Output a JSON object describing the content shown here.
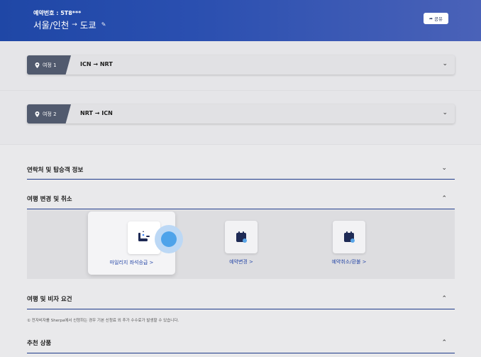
{
  "header": {
    "booking_no": "예약번호 : 5T8***",
    "route_from": "서울/인천",
    "route_arrow": "→",
    "route_to": "도쿄",
    "share_label": "공유",
    "colors": {
      "header_bg": "#2a4fb0",
      "text": "#ffffff"
    }
  },
  "trips": [
    {
      "tag": "여정 1",
      "route": "ICN → NRT"
    },
    {
      "tag": "여정 2",
      "route": "NRT → ICN"
    }
  ],
  "sections": {
    "contact": {
      "title": "연락처 및 탑승객 정보"
    },
    "change": {
      "title": "여행 변경 및 취소",
      "actions": [
        {
          "label": "마일리지 좌석승급 >",
          "icon": "seat-upgrade-icon"
        },
        {
          "label": "예약변경 >",
          "icon": "calendar-change-icon"
        },
        {
          "label": "예약취소/환불 >",
          "icon": "calendar-cancel-icon"
        }
      ]
    },
    "visa": {
      "title": "여행 및 비자 요건",
      "note": "① 전자비자를 Sherpa에서 신청하는 경우 기본 신청료 외 추가 수수료가 발생할 수 있습니다."
    },
    "recommend": {
      "title": "추천 상품"
    }
  },
  "colors": {
    "accent": "#1e3a8a",
    "link": "#2a4aa8",
    "tag_bg": "#515a6e",
    "page_bg": "#e9e9eb"
  }
}
